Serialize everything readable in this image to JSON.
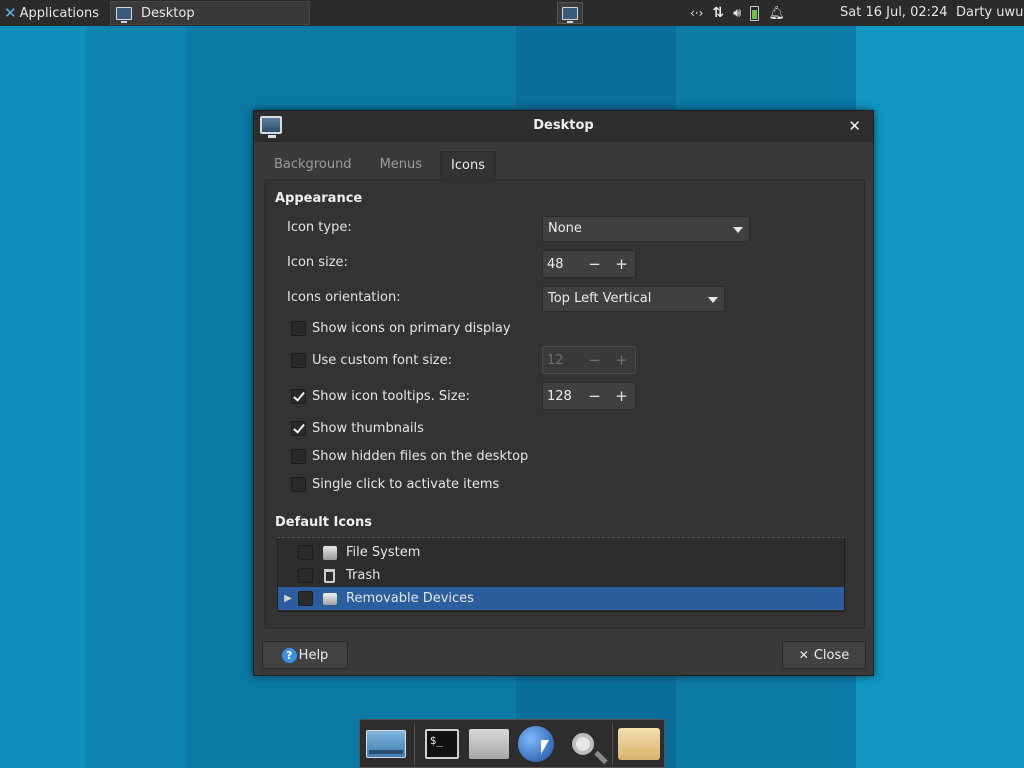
{
  "colors": {
    "desktop_background": "#0f93bd",
    "panel": "#2b2b2b",
    "dialog_body": "#3a3a3a",
    "selection": "#2a5e9f"
  },
  "top_panel": {
    "applications_label": "Applications",
    "task_label": "Desktop",
    "clock": "Sat 16 Jul, 02:24",
    "user": "Darty uwu",
    "tray_icons": [
      "network-icon",
      "transfer-icon",
      "volume-icon",
      "battery-icon",
      "notification-bell-icon"
    ]
  },
  "dialog": {
    "title": "Desktop",
    "tabs": [
      "Background",
      "Menus",
      "Icons"
    ],
    "active_tab": "Icons",
    "appearance": {
      "heading": "Appearance",
      "icon_type_label": "Icon type:",
      "icon_type_value": "None",
      "icon_size_label": "Icon size:",
      "icon_size_value": "48",
      "orientation_label": "Icons orientation:",
      "orientation_value": "Top Left Vertical",
      "show_on_primary_label": "Show icons on primary display",
      "show_on_primary_checked": false,
      "custom_font_label": "Use custom font size:",
      "custom_font_checked": false,
      "custom_font_value": "12",
      "tooltips_label": "Show icon tooltips. Size:",
      "tooltips_checked": true,
      "tooltips_value": "128",
      "thumbnails_label": "Show thumbnails",
      "thumbnails_checked": true,
      "hidden_files_label": "Show hidden files on the desktop",
      "hidden_files_checked": false,
      "single_click_label": "Single click to activate items",
      "single_click_checked": false
    },
    "default_icons": {
      "heading": "Default Icons",
      "items": [
        {
          "label": "File System",
          "checked": false
        },
        {
          "label": "Trash",
          "checked": false
        },
        {
          "label": "Removable Devices",
          "checked": false,
          "selected": true
        }
      ]
    },
    "buttons": {
      "help": "Help",
      "close": "Close"
    }
  },
  "spin_symbols": {
    "minus": "−",
    "plus": "+"
  },
  "dock": {
    "items": [
      "show-desktop-icon",
      "terminal-icon",
      "home-folder-icon",
      "web-browser-icon",
      "search-icon",
      "files-folder-icon"
    ],
    "terminal_glyph": "$_"
  }
}
